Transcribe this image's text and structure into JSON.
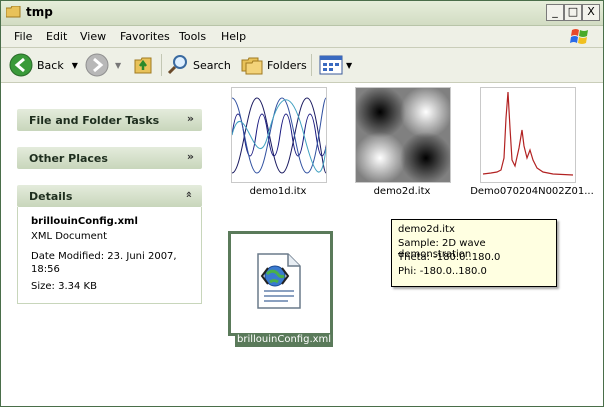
{
  "window": {
    "title": "tmp"
  },
  "title_buttons": {
    "minimize": "_",
    "maximize": "□",
    "close": "X"
  },
  "menu": [
    "File",
    "Edit",
    "View",
    "Favorites",
    "Tools",
    "Help"
  ],
  "toolbar": {
    "back": "Back",
    "search": "Search",
    "folders": "Folders"
  },
  "sidebar": {
    "file_tasks": "File and Folder Tasks",
    "other_places": "Other Places",
    "details": {
      "title": "Details",
      "filename": "brillouinConfig.xml",
      "type": "XML Document",
      "modified": "Date Modified: 23. Juni 2007, 18:56",
      "size": "Size: 3.34 KB"
    }
  },
  "files": [
    {
      "name": "demo1d.itx"
    },
    {
      "name": "demo2d.itx"
    },
    {
      "name": "Demo070204N002Z01..."
    },
    {
      "name": "brillouinConfig.xml"
    }
  ],
  "tooltip": {
    "line1": "demo2d.itx",
    "line2": "Sample: 2D wave demonstration",
    "line3": "Theta: -180.0..180.0",
    "line4": "Phi: -180.0..180.0"
  },
  "colors": {
    "accent": "#5a7a5a",
    "panel": "#c8d6bb",
    "spectrum": "#b22222"
  }
}
